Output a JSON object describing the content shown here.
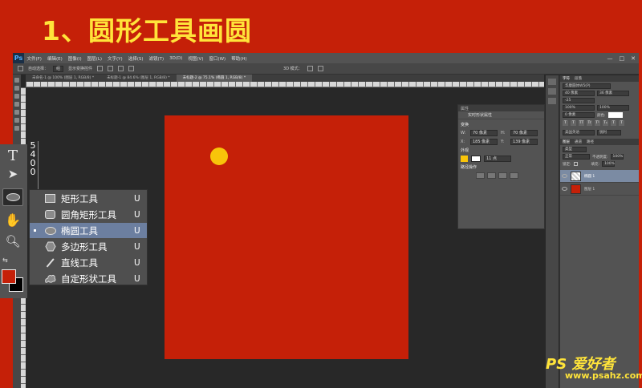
{
  "tutorial": {
    "title": "1、圆形工具画圆"
  },
  "app": {
    "logo": "Ps",
    "menus": [
      "文件(F)",
      "编辑(E)",
      "图像(I)",
      "图层(L)",
      "文字(Y)",
      "选择(S)",
      "滤镜(T)",
      "3D(D)",
      "视图(V)",
      "窗口(W)",
      "帮助(H)"
    ],
    "window_controls": [
      "—",
      "□",
      "✕"
    ]
  },
  "options_bar": {
    "auto_select": "自动选择：",
    "group": "组",
    "show_transform": "显示变换控件",
    "mode_3d": "3D 模式："
  },
  "tabs": [
    {
      "label": "未命名-1 @ 100% (图层 1, RGB/8) *",
      "active": false
    },
    {
      "label": "未标题-1 @ 84.6% (图层 1, RGB/8) *",
      "active": false
    },
    {
      "label": "未标题-2 @ 75.1% (椭圆 1, RGB/8) *",
      "active": true
    }
  ],
  "canvas": {
    "background": "#c52008",
    "shape_color": "#f8c40a"
  },
  "properties_panel": {
    "header": "属性",
    "title": "实时形状属性",
    "size_section": "变换",
    "w_label": "W:",
    "w_value": "70 像素",
    "h_label": "H:",
    "h_value": "70 像素",
    "x_label": "X:",
    "x_value": "185 像素",
    "y_label": "Y:",
    "y_value": "139 像素",
    "appearance_section": "外观",
    "stroke_width": "11 点",
    "path_section": "路径操作"
  },
  "right_dock": {
    "char_tabs": [
      "字符",
      "段落"
    ],
    "font_name": "华康圆体W5(P)",
    "font_size": "40 像素",
    "leading": "36 像素",
    "tracking": "-25",
    "scale_v": "100%",
    "scale_h": "100%",
    "baseline": "0 像素",
    "color_label": "颜色:",
    "type_buttons": [
      "T",
      "T",
      "TT",
      "Tr",
      "T¹",
      "T₁",
      "T",
      "T"
    ],
    "language": "美国英语",
    "aa": "锐利",
    "layer_tabs": [
      "图层",
      "通道",
      "路径"
    ],
    "kind_filter": "类型",
    "blend_mode": "正常",
    "opacity_label": "不透明度:",
    "opacity": "100%",
    "lock_label": "锁定:",
    "fill_label": "填充:",
    "fill": "100%",
    "layers": [
      {
        "name": "椭圆 1",
        "selected": true
      },
      {
        "name": "图层 1",
        "selected": false
      }
    ]
  },
  "ruler_numbers": [
    "5",
    "4",
    "0",
    "0"
  ],
  "flyout": {
    "items": [
      {
        "label": "矩形工具",
        "key": "U",
        "icon": "rectangle-icon",
        "selected": false
      },
      {
        "label": "圆角矩形工具",
        "key": "U",
        "icon": "rounded-rectangle-icon",
        "selected": false
      },
      {
        "label": "椭圆工具",
        "key": "U",
        "icon": "ellipse-icon",
        "selected": true
      },
      {
        "label": "多边形工具",
        "key": "U",
        "icon": "polygon-icon",
        "selected": false
      },
      {
        "label": "直线工具",
        "key": "U",
        "icon": "line-icon",
        "selected": false
      },
      {
        "label": "自定形状工具",
        "key": "U",
        "icon": "custom-shape-icon",
        "selected": false
      }
    ]
  },
  "tools": {
    "text": "T",
    "foreground": "#c52008",
    "background": "#000000"
  },
  "watermark": {
    "brand": "PS 爱好者",
    "site": "www.psahz.com"
  }
}
